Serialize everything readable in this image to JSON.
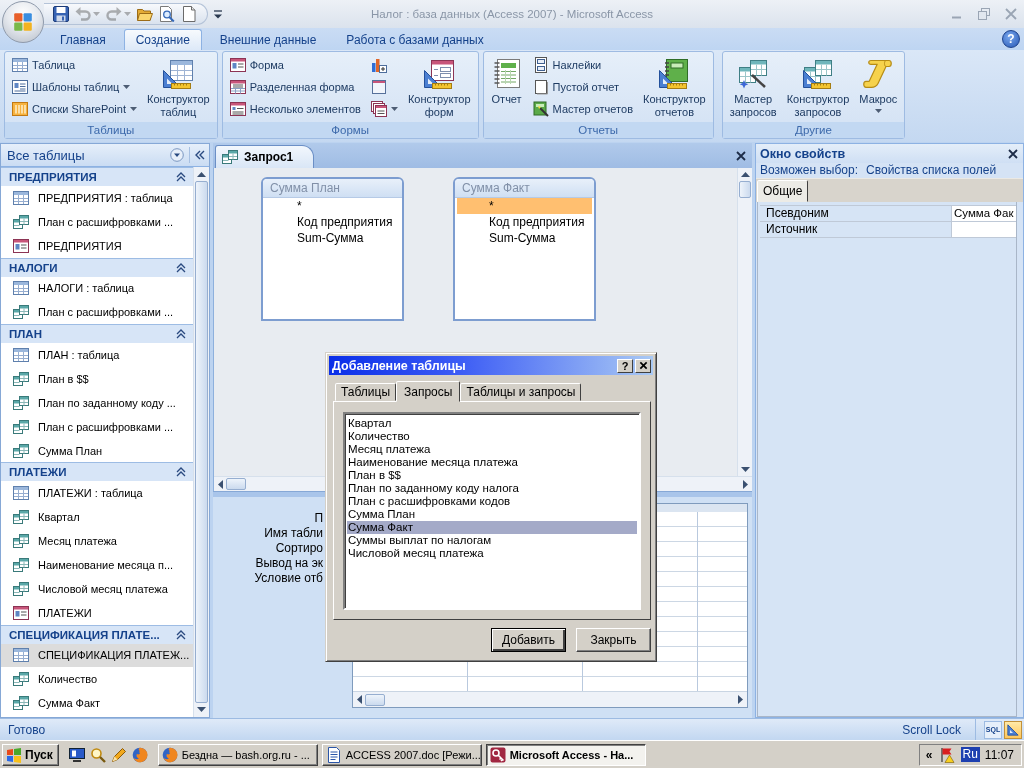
{
  "window": {
    "title": "Налог : база данных (Access 2007) - Microsoft Access"
  },
  "quick_access": [
    {
      "disabled": false,
      "dropdown": false
    },
    {
      "disabled": true,
      "dropdown": true
    },
    {
      "disabled": true,
      "dropdown": true
    },
    {
      "disabled": false,
      "dropdown": false
    },
    {
      "disabled": false,
      "dropdown": false
    },
    {
      "disabled": false,
      "dropdown": false
    }
  ],
  "ribbon": {
    "tabs": [
      {
        "label": "Главная",
        "selected": false
      },
      {
        "label": "Создание",
        "selected": true
      },
      {
        "label": "Внешние данные",
        "selected": false
      },
      {
        "label": "Работа с базами данных",
        "selected": false
      }
    ],
    "help": "?",
    "groups": [
      {
        "title": "Таблицы",
        "columns": [
          {
            "kind": "stack",
            "items": [
              {
                "label": "Таблица",
                "dropdown": false
              },
              {
                "label": "Шаблоны таблиц",
                "dropdown": true
              },
              {
                "label": "Списки SharePoint",
                "dropdown": true
              }
            ]
          },
          {
            "kind": "large",
            "label": "Конструктор таблиц",
            "dropdown": false
          }
        ]
      },
      {
        "title": "Формы",
        "columns": [
          {
            "kind": "stack",
            "items": [
              {
                "label": "Форма",
                "dropdown": false
              },
              {
                "label": "Разделенная форма",
                "dropdown": false
              },
              {
                "label": "Несколько элементов",
                "dropdown": false
              }
            ]
          },
          {
            "kind": "stack",
            "items": [
              {
                "dropdown": false
              },
              {
                "dropdown": false
              },
              {
                "dropdown": true
              }
            ]
          },
          {
            "kind": "large",
            "label": "Конструктор форм",
            "dropdown": false
          }
        ]
      },
      {
        "title": "Отчеты",
        "columns": [
          {
            "kind": "large",
            "label": "Отчет",
            "dropdown": false
          },
          {
            "kind": "stack",
            "items": [
              {
                "label": "Наклейки",
                "dropdown": false
              },
              {
                "label": "Пустой отчет",
                "dropdown": false
              },
              {
                "label": "Мастер отчетов",
                "dropdown": false
              }
            ]
          },
          {
            "kind": "large",
            "label": "Конструктор отчетов",
            "dropdown": false
          }
        ]
      },
      {
        "title": "Другие",
        "columns": [
          {
            "kind": "large",
            "label": "Мастер запросов",
            "dropdown": false
          },
          {
            "kind": "large",
            "label": "Конструктор запросов",
            "dropdown": false
          },
          {
            "kind": "large",
            "label": "Макрос",
            "dropdown": true
          }
        ]
      }
    ]
  },
  "nav_pane": {
    "title": "Все таблицы",
    "groups": [
      {
        "title": "ПРЕДПРИЯТИЯ",
        "expanded": true,
        "items": [
          {
            "kind": "table",
            "label": "ПРЕДПРИЯТИЯ : таблица",
            "selected": false
          },
          {
            "kind": "query",
            "label": "План с расшифровками ...",
            "selected": false
          },
          {
            "kind": "form",
            "label": "ПРЕДПРИЯТИЯ",
            "selected": false
          }
        ]
      },
      {
        "title": "НАЛОГИ",
        "expanded": true,
        "items": [
          {
            "kind": "table",
            "label": "НАЛОГИ : таблица",
            "selected": false
          },
          {
            "kind": "query",
            "label": "План с расшифровками ...",
            "selected": false
          }
        ]
      },
      {
        "title": "ПЛАН",
        "expanded": true,
        "items": [
          {
            "kind": "table",
            "label": "ПЛАН : таблица",
            "selected": false
          },
          {
            "kind": "query",
            "label": "План в $$",
            "selected": false
          },
          {
            "kind": "query",
            "label": "План по заданному коду ...",
            "selected": false
          },
          {
            "kind": "query",
            "label": "План с расшифровками ...",
            "selected": false
          },
          {
            "kind": "query",
            "label": "Сумма План",
            "selected": false
          }
        ]
      },
      {
        "title": "ПЛАТЕЖИ",
        "expanded": true,
        "items": [
          {
            "kind": "table",
            "label": "ПЛАТЕЖИ : таблица",
            "selected": false
          },
          {
            "kind": "query",
            "label": "Квартал",
            "selected": false
          },
          {
            "kind": "query",
            "label": "Месяц платежа",
            "selected": false
          },
          {
            "kind": "query",
            "label": "Наименование месяца п...",
            "selected": false
          },
          {
            "kind": "query",
            "label": "Числовой месяц платежа",
            "selected": false
          },
          {
            "kind": "form",
            "label": "ПЛАТЕЖИ",
            "selected": false
          }
        ]
      },
      {
        "title": "СПЕЦИФИКАЦИЯ ПЛАТЕ...",
        "expanded": true,
        "items": [
          {
            "kind": "table",
            "label": "СПЕЦИФИКАЦИЯ ПЛАТЕЖ...",
            "selected": true
          },
          {
            "kind": "query",
            "label": "Количество",
            "selected": false
          },
          {
            "kind": "query",
            "label": "Сумма Факт",
            "selected": false
          }
        ]
      }
    ]
  },
  "document": {
    "tab": {
      "label": "Запрос1"
    },
    "field_lists": [
      {
        "title": "Сумма План",
        "fields": [
          {
            "label": "*",
            "selected": false
          },
          {
            "label": "Код предприятия",
            "selected": false
          },
          {
            "label": "Sum-Сумма",
            "selected": false
          }
        ]
      },
      {
        "title": "Сумма Факт",
        "fields": [
          {
            "label": "*",
            "selected": true
          },
          {
            "label": "Код предприятия",
            "selected": false
          },
          {
            "label": "Sum-Сумма",
            "selected": false
          }
        ]
      }
    ],
    "grid": {
      "row_labels": [
        "П",
        "Имя табли",
        "Сортиро",
        "Вывод на эк",
        "Условие отб"
      ]
    }
  },
  "dialog": {
    "title": "Добавление таблицы",
    "help": "?",
    "tabs": [
      {
        "label": "Таблицы",
        "selected": false
      },
      {
        "label": "Запросы",
        "selected": true
      },
      {
        "label": "Таблицы и запросы",
        "selected": false
      }
    ],
    "items": [
      {
        "label": "Квартал",
        "selected": false
      },
      {
        "label": "Количество",
        "selected": false
      },
      {
        "label": "Месяц платежа",
        "selected": false
      },
      {
        "label": "Наименование месяца платежа",
        "selected": false
      },
      {
        "label": "План в $$",
        "selected": false
      },
      {
        "label": "План по заданному коду налога",
        "selected": false
      },
      {
        "label": "План с расшифровками кодов",
        "selected": false
      },
      {
        "label": "Сумма План",
        "selected": false
      },
      {
        "label": "Сумма Факт",
        "selected": true
      },
      {
        "label": "Суммы выплат по налогам",
        "selected": false
      },
      {
        "label": "Числовой месяц платежа",
        "selected": false
      }
    ],
    "buttons": [
      {
        "label": "Добавить",
        "default": true
      },
      {
        "label": "Закрыть",
        "default": false
      }
    ]
  },
  "property_sheet": {
    "title": "Окно свойств",
    "selection_label": "Возможен выбор:",
    "selection_value": "Свойства списка полей",
    "tabs": [
      {
        "label": "Общие",
        "selected": true
      }
    ],
    "properties": [
      {
        "name": "Псевдоним",
        "value": "Сумма Фак"
      },
      {
        "name": "Источник"
      }
    ]
  },
  "status_bar": {
    "text": "Готово",
    "indicator": "Scroll Lock",
    "views": [
      {
        "kind": "sql",
        "label": "SQL",
        "selected": false
      },
      {
        "kind": "design",
        "selected": true
      }
    ]
  },
  "taskbar": {
    "start": "Пуск",
    "tasks": [
      {
        "label": "Бездна — bash.org.ru - ...",
        "selected": false
      },
      {
        "label": "ACCESS 2007.doc [Режи...",
        "selected": false
      },
      {
        "label": "Microsoft Access - На...",
        "selected": true
      }
    ],
    "tray": {
      "expand": "«",
      "language": "Ru",
      "time": "11:07"
    }
  }
}
